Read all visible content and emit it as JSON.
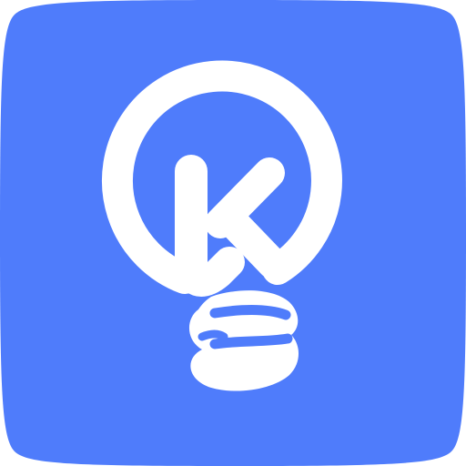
{
  "icon": {
    "name": "lightbulb-k-logo",
    "background_color": "#4f7cfb",
    "foreground_color": "#ffffff"
  }
}
